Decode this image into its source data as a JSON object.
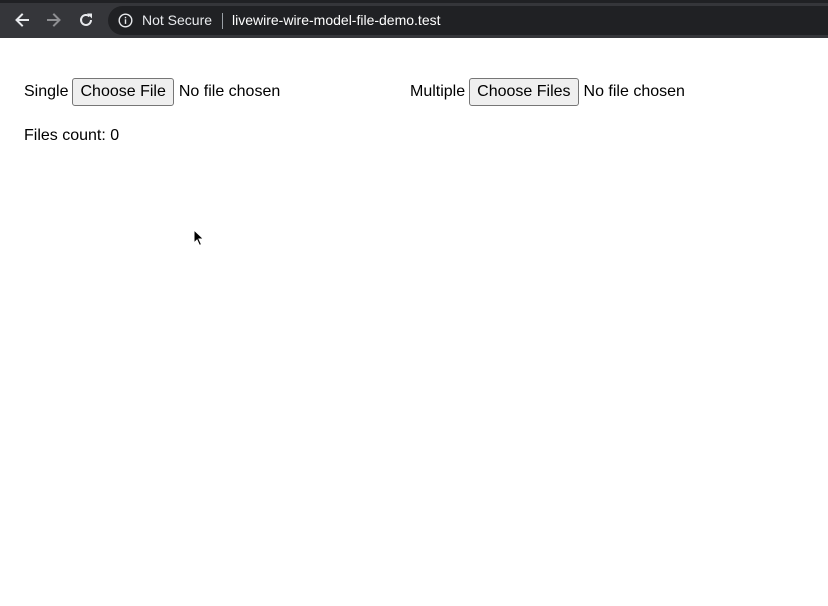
{
  "browser": {
    "security_label": "Not Secure",
    "url": "livewire-wire-model-file-demo.test",
    "icons": {
      "back": "back-arrow-icon",
      "forward": "forward-arrow-icon",
      "reload": "reload-icon",
      "info": "info-icon"
    }
  },
  "page": {
    "single": {
      "label": "Single",
      "button_label": "Choose File",
      "status": "No file chosen"
    },
    "multiple": {
      "label": "Multiple",
      "button_label": "Choose Files",
      "status": "No file chosen"
    },
    "files_count": "Files count: 0"
  }
}
